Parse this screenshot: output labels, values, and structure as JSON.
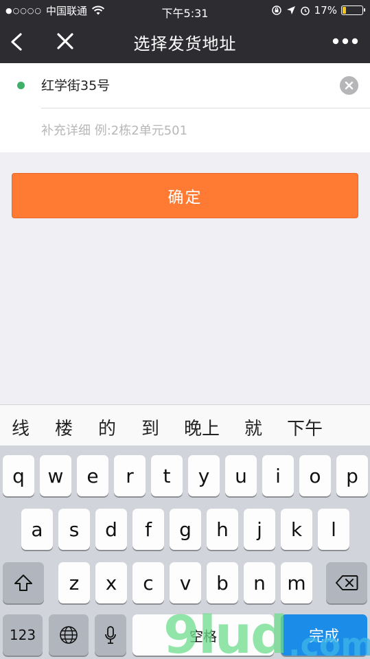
{
  "status_bar": {
    "signal_dots": "●○○○○",
    "carrier": "中国联通",
    "time": "下午5:31",
    "battery_percent": "17%",
    "battery_level": 0.17
  },
  "nav": {
    "title": "选择发货地址"
  },
  "address": {
    "main": "红学街35号",
    "detail_value": "",
    "detail_placeholder": "补充详细 例:2栋2单元501"
  },
  "confirm_label": "确定",
  "candidates": [
    "线",
    "楼",
    "的",
    "到",
    "晚上",
    "就",
    "下午"
  ],
  "keyboard": {
    "row1": [
      "q",
      "w",
      "e",
      "r",
      "t",
      "y",
      "u",
      "i",
      "o",
      "p"
    ],
    "row2": [
      "a",
      "s",
      "d",
      "f",
      "g",
      "h",
      "j",
      "k",
      "l"
    ],
    "row3": [
      "z",
      "x",
      "c",
      "v",
      "b",
      "n",
      "m"
    ],
    "numbers_label": "123",
    "space_label": "空格",
    "done_label": "完成"
  },
  "watermark": {
    "main": "9lud",
    "domain": ".com"
  },
  "colors": {
    "nav_bg": "#2d2c31",
    "accent_button": "#ff7b33",
    "dot_green": "#3eb06a",
    "done_key": "#1b8de8"
  }
}
